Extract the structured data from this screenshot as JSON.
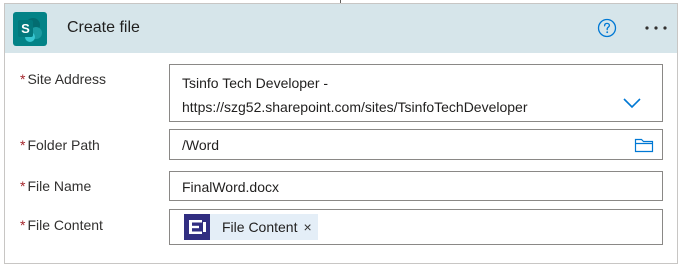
{
  "header": {
    "title": "Create file",
    "app_icon": "sharepoint-icon",
    "help_icon": "help-circle-icon",
    "more_icon": "more-dots-icon",
    "background_color": "#d6e5ea",
    "app_icon_color": "#038387"
  },
  "fields": [
    {
      "label": "Site Address",
      "required_mark": "*",
      "value_line1": "Tsinfo Tech Developer -",
      "value_line2": "https://szg52.sharepoint.com/sites/TsinfoTechDeveloper",
      "icon": "chevron-down-icon"
    },
    {
      "label": "Folder Path",
      "required_mark": "*",
      "value": "/Word",
      "icon": "folder-icon"
    },
    {
      "label": "File Name",
      "required_mark": "*",
      "value": "FinalWord.docx"
    },
    {
      "label": "File Content",
      "required_mark": "*",
      "token": {
        "label": "File Content",
        "remove": "×",
        "icon": "dynamic-content-icon",
        "icon_color": "#312e81"
      }
    }
  ],
  "colors": {
    "required": "#a4262c",
    "accent": "#0078d4",
    "token_background": "#e4eef7"
  }
}
